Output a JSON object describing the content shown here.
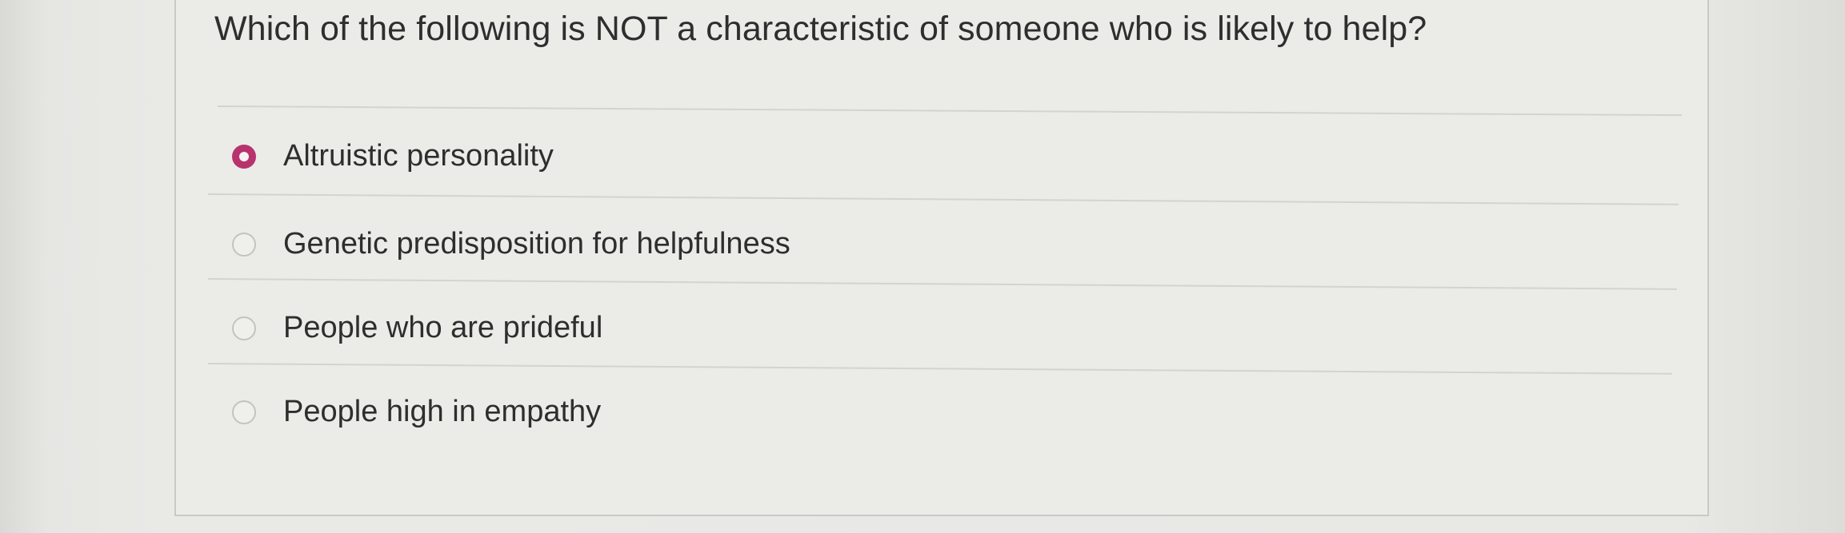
{
  "question": {
    "text": "Which of the following is NOT a characteristic of someone who is likely to help?"
  },
  "options": [
    {
      "label": "Altruistic personality",
      "selected": true
    },
    {
      "label": "Genetic predisposition for helpfulness",
      "selected": false
    },
    {
      "label": "People who are prideful",
      "selected": false
    },
    {
      "label": "People high in empathy",
      "selected": false
    }
  ],
  "colors": {
    "accent": "#b8326e",
    "text": "#2e2e2e",
    "card": "#ebebe8"
  }
}
